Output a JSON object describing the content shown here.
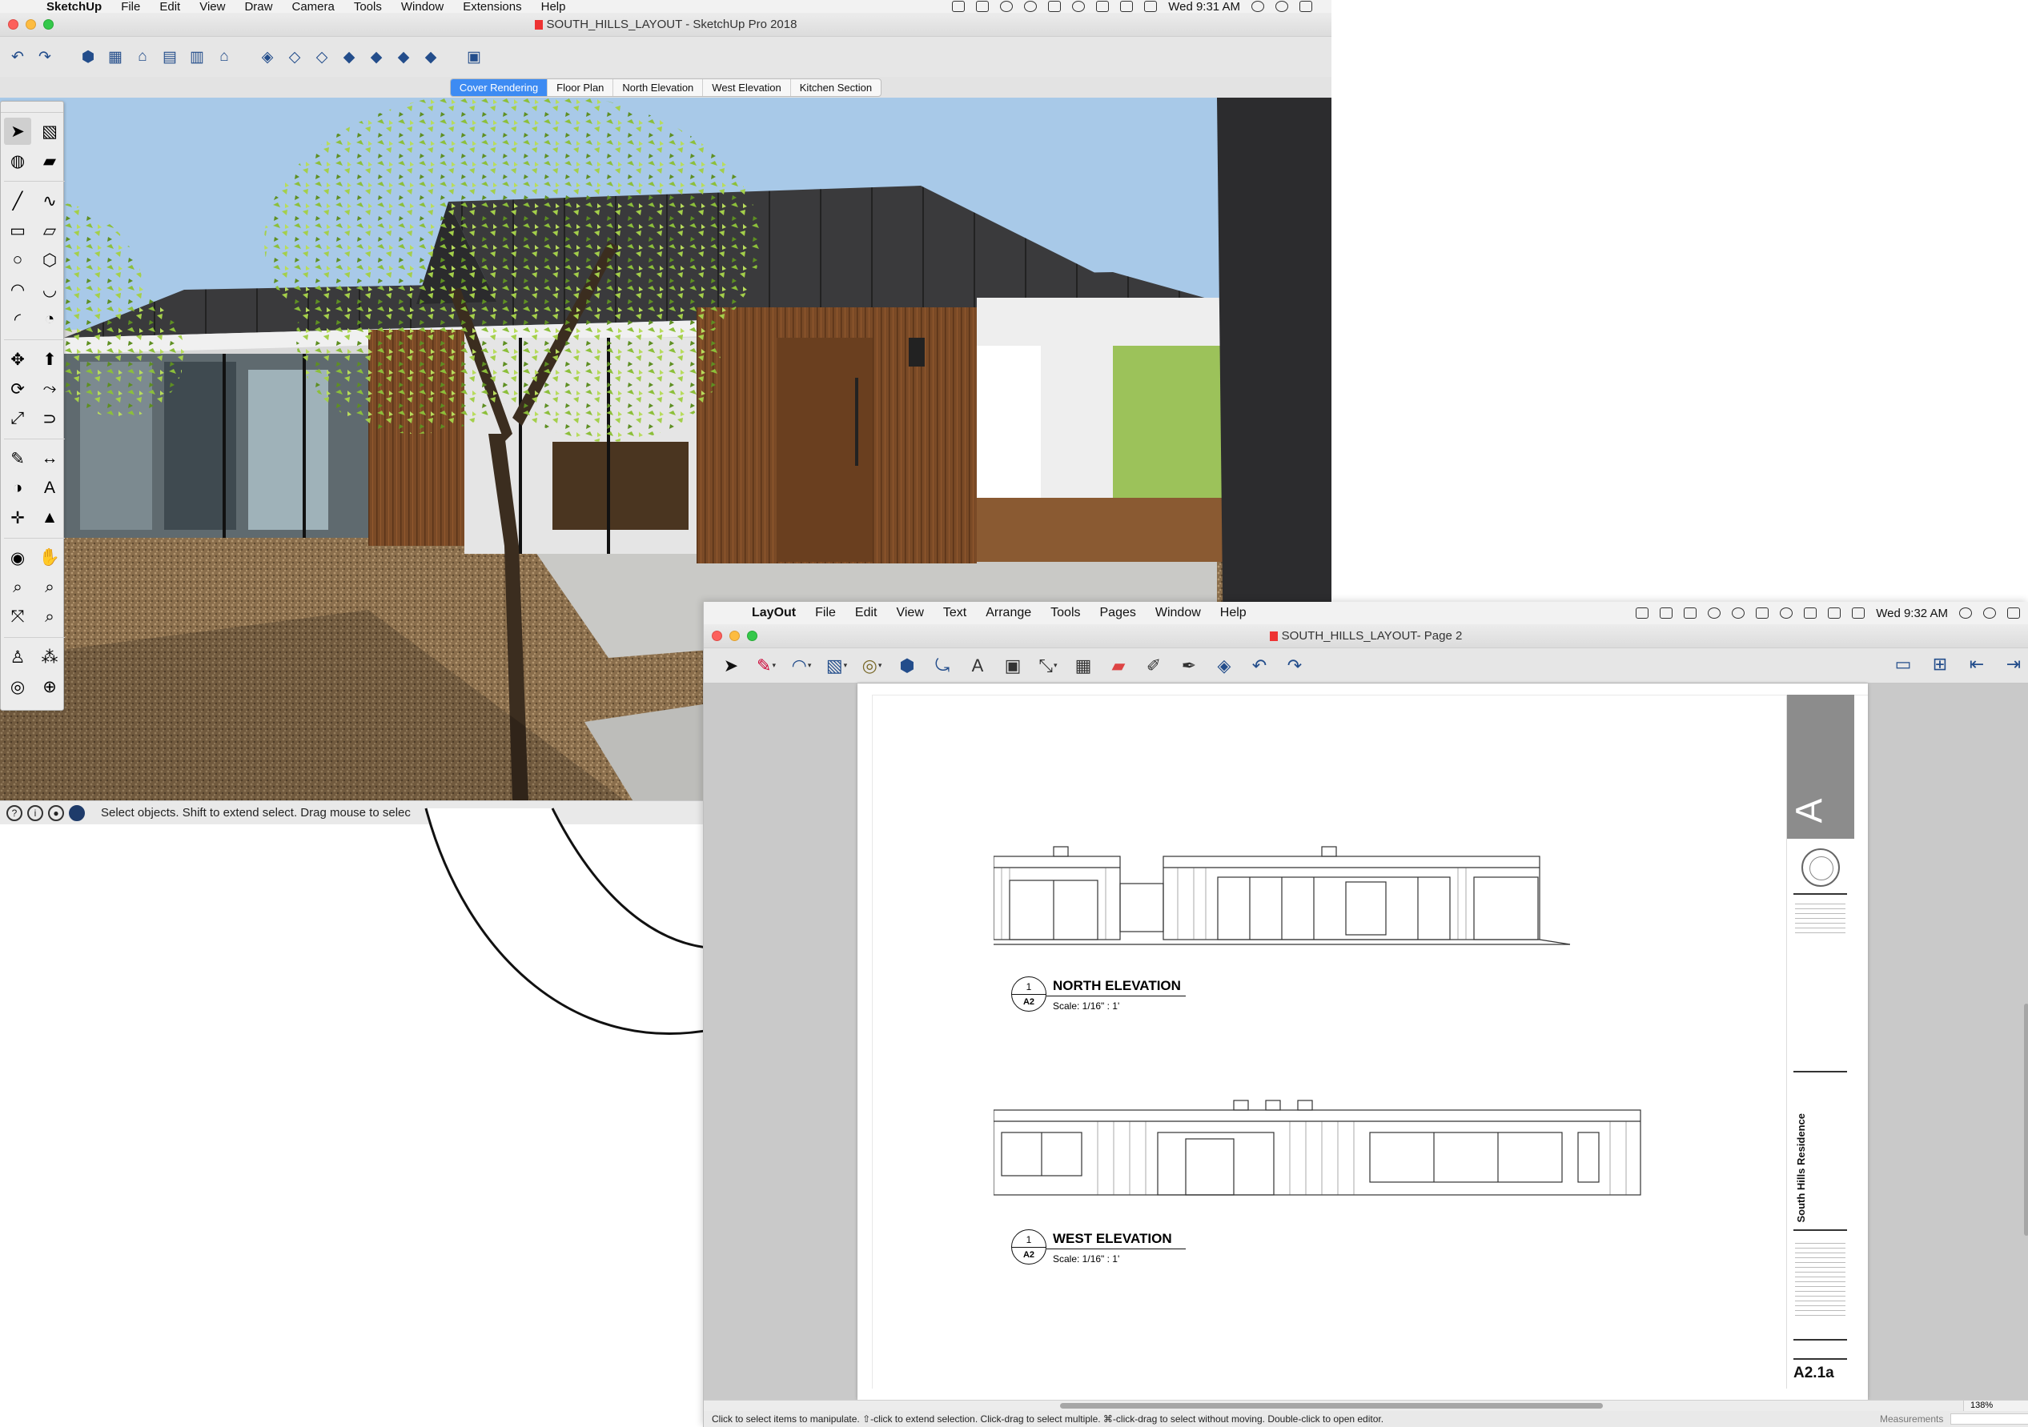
{
  "sketchup": {
    "menubar": {
      "app_name": "SketchUp",
      "items": [
        "File",
        "Edit",
        "View",
        "Draw",
        "Camera",
        "Tools",
        "Window",
        "Extensions",
        "Help"
      ],
      "clock": "Wed 9:31 AM"
    },
    "window_title": "SOUTH_HILLS_LAYOUT - SketchUp Pro 2018",
    "toolbar_icons": [
      "undo-icon",
      "redo-icon",
      "iso-view-icon",
      "top-view-icon",
      "front-view-icon",
      "right-view-icon",
      "back-view-icon",
      "left-view-icon",
      "xray-style-icon",
      "wireframe-style-icon",
      "hidden-line-style-icon",
      "shaded-style-icon",
      "shaded-textures-style-icon",
      "monochrome-style-icon",
      "section-plane-icon"
    ],
    "scene_tabs": [
      {
        "label": "Cover Rendering",
        "active": true
      },
      {
        "label": "Floor Plan",
        "active": false
      },
      {
        "label": "North Elevation",
        "active": false
      },
      {
        "label": "West Elevation",
        "active": false
      },
      {
        "label": "Kitchen Section",
        "active": false
      }
    ],
    "status_text": "Select objects. Shift to extend select. Drag mouse to selec"
  },
  "layout": {
    "menubar": {
      "app_name": "LayOut",
      "items": [
        "File",
        "Edit",
        "View",
        "Text",
        "Arrange",
        "Tools",
        "Pages",
        "Window",
        "Help"
      ],
      "clock": "Wed 9:32 AM"
    },
    "window_title": "SOUTH_HILLS_LAYOUT- Page 2",
    "page": {
      "elevations": [
        {
          "number": "1",
          "sheet": "A2",
          "title": "NORTH ELEVATION",
          "scale": "Scale: 1/16\" : 1'"
        },
        {
          "number": "1",
          "sheet": "A2",
          "title": "WEST ELEVATION",
          "scale": "Scale: 1/16\" : 1'"
        }
      ],
      "title_block": {
        "project_name": "South Hills Residence",
        "sheet_number": "A2.1a"
      }
    },
    "zoom": "138%",
    "status_text": "Click to select items to manipulate. ⇧-click to extend selection. Click-drag to select multiple. ⌘-click-drag to select without moving. Double-click to open editor.",
    "measurements_label": "Measurements"
  },
  "colors": {
    "tab_active": "#3d8bf3",
    "sky": "#a8c9e8",
    "gravel": "#8a6e4c",
    "wood": "#7a4a26",
    "dark_cladding": "#3a3a3c",
    "foliage": "#8cbf3a"
  }
}
